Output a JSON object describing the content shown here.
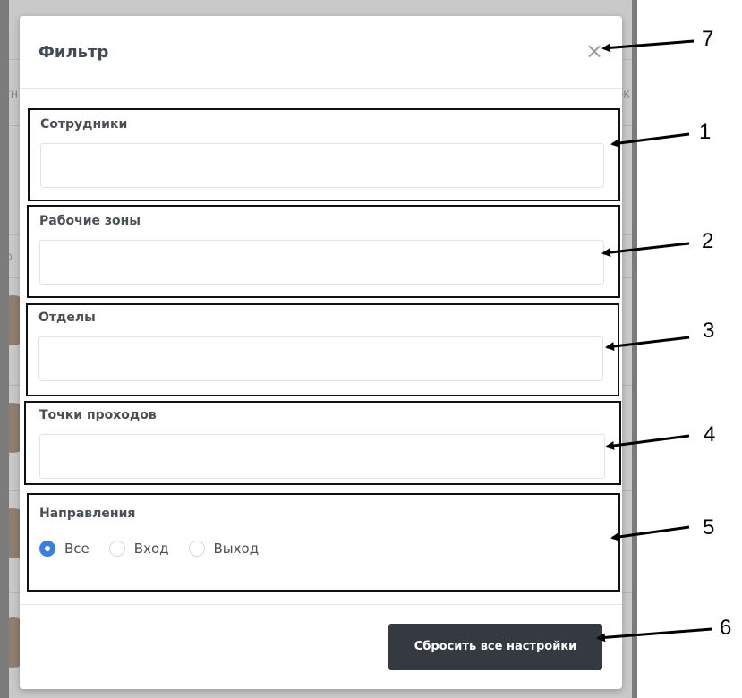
{
  "background": {
    "side_text": [
      "тн",
      "рк",
      "о"
    ],
    "colors": {
      "overlay": "#7b7b7b",
      "page": "#c9c9c9"
    }
  },
  "modal": {
    "title": "Фильтр",
    "close_symbol": "×",
    "fields": [
      {
        "label": "Сотрудники",
        "value": ""
      },
      {
        "label": "Рабочие зоны",
        "value": ""
      },
      {
        "label": "Отделы",
        "value": ""
      },
      {
        "label": "Точки проходов",
        "value": ""
      }
    ],
    "directions": {
      "label": "Направления",
      "options": [
        {
          "label": "Все",
          "checked": true
        },
        {
          "label": "Вход",
          "checked": false
        },
        {
          "label": "Выход",
          "checked": false
        }
      ]
    },
    "reset_button": "Сбросить все настройки",
    "colors": {
      "accent": "#3d7ed8",
      "button": "#343a40",
      "annotation_border": "#111111"
    }
  },
  "annotations": [
    "1",
    "2",
    "3",
    "4",
    "5",
    "6",
    "7"
  ]
}
